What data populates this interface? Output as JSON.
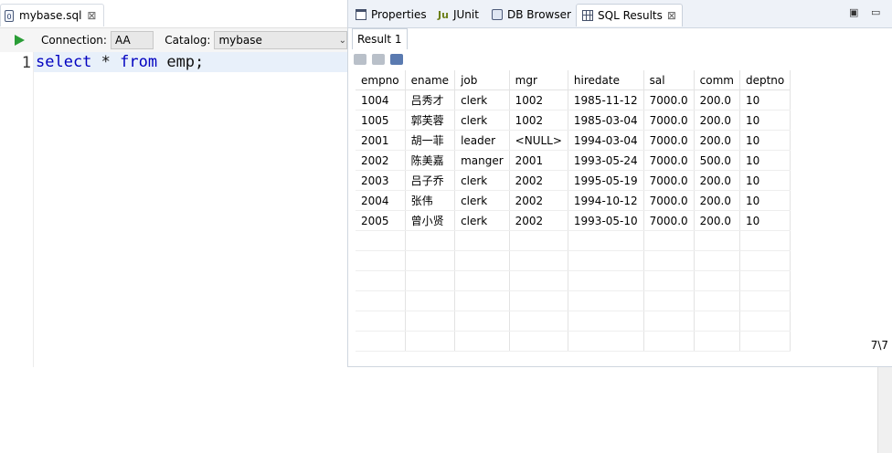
{
  "editor": {
    "tab_label": "mybase.sql",
    "file_icon_text": "0",
    "toolbar": {
      "connection_label": "Connection:",
      "connection_value": "AA",
      "catalog_label": "Catalog:",
      "catalog_value": "mybase"
    },
    "line_number": "1",
    "code": {
      "kw1": "select",
      "mid": " * ",
      "kw2": "from",
      "rest": " emp;"
    }
  },
  "view_tabs": {
    "properties": "Properties",
    "junit": "JUnit",
    "junit_icon_text": "Ju",
    "db_browser": "DB Browser",
    "sql_results": "SQL Results"
  },
  "results": {
    "tab_label": "Result 1",
    "columns": [
      "empno",
      "ename",
      "job",
      "mgr",
      "hiredate",
      "sal",
      "comm",
      "deptno"
    ],
    "rows": [
      [
        "1004",
        "吕秀才",
        "clerk",
        "1002",
        "1985-11-12",
        "7000.0",
        "200.0",
        "10"
      ],
      [
        "1005",
        "郭芙蓉",
        "clerk",
        "1002",
        "1985-03-04",
        "7000.0",
        "200.0",
        "10"
      ],
      [
        "2001",
        "胡一菲",
        "leader",
        "<NULL>",
        "1994-03-04",
        "7000.0",
        "200.0",
        "10"
      ],
      [
        "2002",
        "陈美嘉",
        "manger",
        "2001",
        "1993-05-24",
        "7000.0",
        "500.0",
        "10"
      ],
      [
        "2003",
        "吕子乔",
        "clerk",
        "2002",
        "1995-05-19",
        "7000.0",
        "200.0",
        "10"
      ],
      [
        "2004",
        "张伟",
        "clerk",
        "2002",
        "1994-10-12",
        "7000.0",
        "200.0",
        "10"
      ],
      [
        "2005",
        "曾小贤",
        "clerk",
        "2002",
        "1993-05-10",
        "7000.0",
        "200.0",
        "10"
      ]
    ],
    "row_count": "7\\7"
  }
}
